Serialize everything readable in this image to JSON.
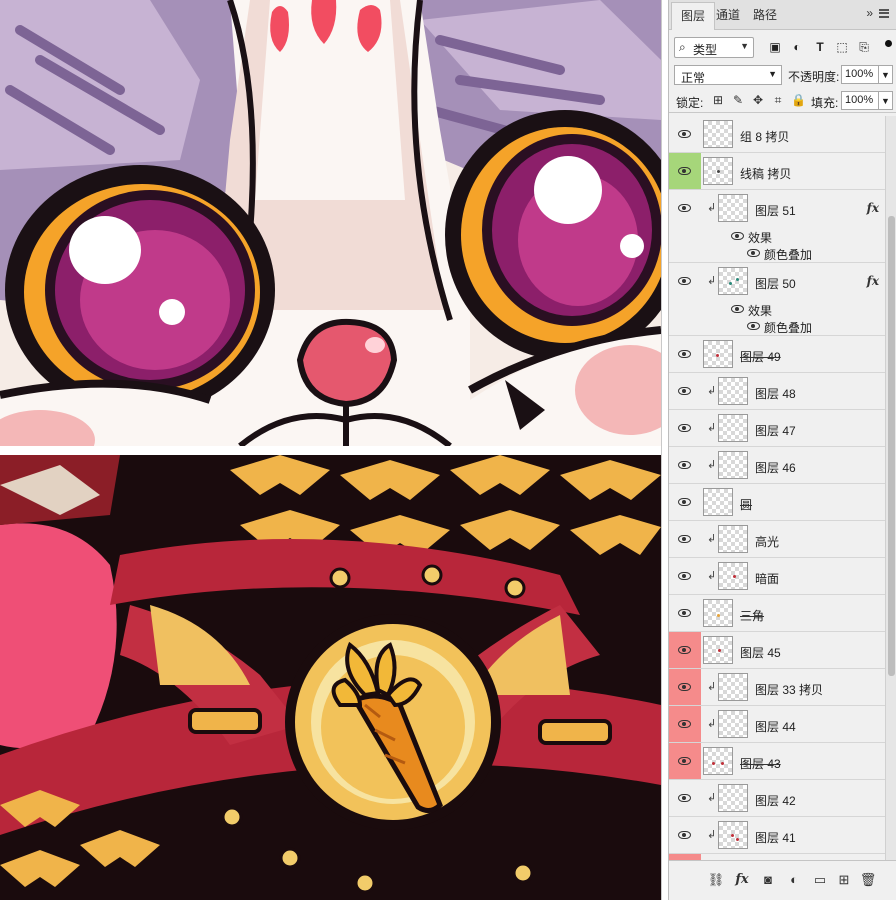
{
  "panel": {
    "tabs": [
      {
        "label": "图层",
        "active": true
      },
      {
        "label": "通道",
        "active": false
      },
      {
        "label": "路径",
        "active": false
      }
    ],
    "menu_glyph": "»"
  },
  "filter": {
    "kind_label": "类型",
    "icons": [
      "image-filter-icon",
      "adjustment-filter-icon",
      "type-filter-icon",
      "shape-filter-icon",
      "smart-object-filter-icon"
    ]
  },
  "blend": {
    "mode": "正常",
    "opacity_label": "不透明度:",
    "opacity_value": "100%"
  },
  "lock": {
    "label": "锁定:",
    "fill_label": "填充:",
    "fill_value": "100%"
  },
  "layers": [
    {
      "name": "组 8 拷贝",
      "vis_color": "",
      "clipped": false
    },
    {
      "name": "线稿 拷贝",
      "vis_color": "#a6d67a",
      "clipped": false
    },
    {
      "name": "图层 51",
      "vis_color": "",
      "clipped": true,
      "fx": "fx",
      "effects_label": "效果",
      "effect": "颜色叠加"
    },
    {
      "name": "图层 50",
      "vis_color": "",
      "clipped": true,
      "fx": "fx",
      "effects_label": "效果",
      "effect": "颜色叠加"
    },
    {
      "name": "图层 49",
      "vis_color": "",
      "clipped": false
    },
    {
      "name": "图层 48",
      "vis_color": "",
      "clipped": true
    },
    {
      "name": "图层 47",
      "vis_color": "",
      "clipped": true
    },
    {
      "name": "图层 46",
      "vis_color": "",
      "clipped": true
    },
    {
      "name": "圆",
      "vis_color": "",
      "clipped": false
    },
    {
      "name": "高光",
      "vis_color": "",
      "clipped": true
    },
    {
      "name": "暗面",
      "vis_color": "",
      "clipped": true
    },
    {
      "name": "三角",
      "vis_color": "",
      "clipped": false
    },
    {
      "name": "图层 45",
      "vis_color": "#f58b8b",
      "clipped": false
    },
    {
      "name": "图层 33 拷贝",
      "vis_color": "#f58b8b",
      "clipped": true
    },
    {
      "name": "图层 44",
      "vis_color": "#f58b8b",
      "clipped": true
    },
    {
      "name": "图层 43",
      "vis_color": "#f58b8b",
      "clipped": false
    },
    {
      "name": "图层 42",
      "vis_color": "",
      "clipped": true
    },
    {
      "name": "图层 41",
      "vis_color": "",
      "clipped": true
    }
  ],
  "colors": {
    "accent_green": "#a6d67a",
    "accent_red": "#f58b8b",
    "panel_bg": "#f0f0f0"
  },
  "bottom_bar": [
    "link-layers-icon",
    "fx-icon",
    "mask-icon",
    "adjustment-layer-icon",
    "group-folder-icon",
    "new-layer-icon",
    "trash-icon"
  ]
}
